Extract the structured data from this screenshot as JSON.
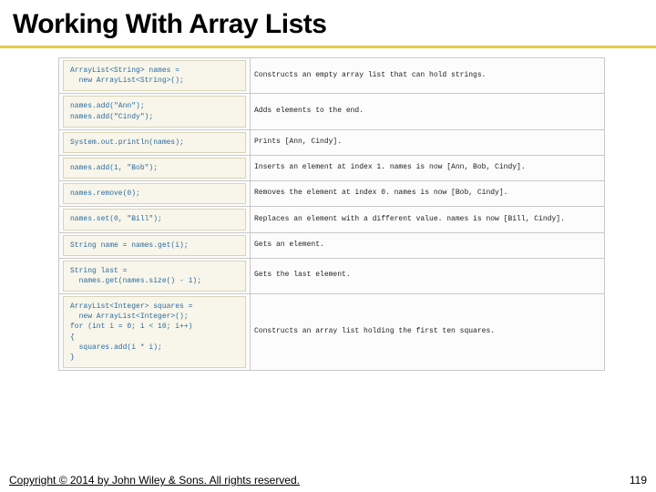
{
  "title": "Working With Array Lists",
  "rows": [
    {
      "code": "ArrayList<String> names =\n  new ArrayList<String>();",
      "desc": "Constructs an empty array list that can hold strings."
    },
    {
      "code": "names.add(\"Ann\");\nnames.add(\"Cindy\");",
      "desc": "Adds elements to the end."
    },
    {
      "code": "System.out.println(names);",
      "desc": "Prints [Ann, Cindy]."
    },
    {
      "code": "names.add(1, \"Bob\");",
      "desc": "Inserts an element at index 1. names is now [Ann, Bob, Cindy]."
    },
    {
      "code": "names.remove(0);",
      "desc": "Removes the element at index 0. names is now [Bob, Cindy]."
    },
    {
      "code": "names.set(0, \"Bill\");",
      "desc": "Replaces an element with a different value. names is now [Bill, Cindy]."
    },
    {
      "code": "String name = names.get(i);",
      "desc": "Gets an element."
    },
    {
      "code": "String last =\n  names.get(names.size() - 1);",
      "desc": "Gets the last element."
    },
    {
      "code": "ArrayList<Integer> squares =\n  new ArrayList<Integer>();\nfor (int i = 0; i < 10; i++)\n{\n  squares.add(i * i);\n}",
      "desc": "Constructs an array list holding the first ten squares."
    }
  ],
  "footer": {
    "copyright": "Copyright © 2014 by John Wiley & Sons. All rights reserved.",
    "page": "119"
  }
}
